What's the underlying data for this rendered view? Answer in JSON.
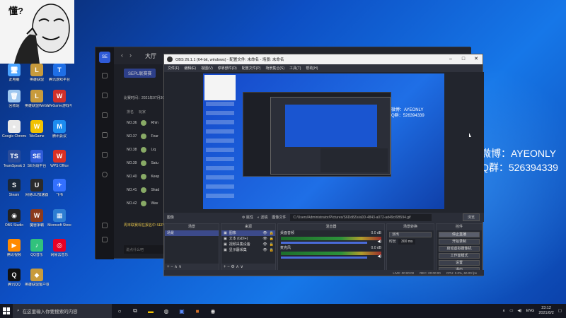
{
  "meme": {
    "caption": "懂?"
  },
  "desktop_icons": [
    {
      "label": "此电脑",
      "icon": "computer-icon",
      "color": "#4aa3ff",
      "glyph": "🖥"
    },
    {
      "label": "英雄联盟",
      "icon": "lol-icon",
      "color": "#c89b3c",
      "glyph": "L"
    },
    {
      "label": "腾讯游戏平台",
      "icon": "tencent-games-icon",
      "color": "#1f6fe6",
      "glyph": "T"
    },
    {
      "label": "回收站",
      "icon": "recycle-bin-icon",
      "color": "#9ec7ef",
      "glyph": "🗑"
    },
    {
      "label": "英雄联盟WeGame版",
      "icon": "lol-wegame-icon",
      "color": "#c89b3c",
      "glyph": "L"
    },
    {
      "label": "WeGame游戏平台",
      "icon": "wegame-icon",
      "color": "#d0302a",
      "glyph": "W"
    },
    {
      "label": "Google Chrome",
      "icon": "chrome-icon",
      "color": "#e8e8e8",
      "glyph": "●"
    },
    {
      "label": "WeGame",
      "icon": "wegame-yellow-icon",
      "color": "#f2c200",
      "glyph": "W"
    },
    {
      "label": "腾讯会议",
      "icon": "tencent-meeting-icon",
      "color": "#1c8cf0",
      "glyph": "M"
    },
    {
      "label": "TeamSpeak 3",
      "icon": "teamspeak-icon",
      "color": "#2a4c9a",
      "glyph": "TS"
    },
    {
      "label": "SE对战平台",
      "icon": "se-icon",
      "color": "#2f5bd8",
      "glyph": "SE"
    },
    {
      "label": "WPS Office",
      "icon": "wps-icon",
      "color": "#d93025",
      "glyph": "W"
    },
    {
      "label": "Steam",
      "icon": "steam-icon",
      "color": "#1b2838",
      "glyph": "S"
    },
    {
      "label": "网易UU加速器",
      "icon": "uu-icon",
      "color": "#2b2b2b",
      "glyph": "U"
    },
    {
      "label": "飞书",
      "icon": "feishu-icon",
      "color": "#3370ff",
      "glyph": "✈"
    },
    {
      "label": "OBS Studio",
      "icon": "obs-icon",
      "color": "#222",
      "glyph": "◉"
    },
    {
      "label": "魔兽争霸",
      "icon": "warcraft-icon",
      "color": "#8a3a1c",
      "glyph": "W"
    },
    {
      "label": "Microsoft Store",
      "icon": "store-icon",
      "color": "#2d7dd2",
      "glyph": "▦"
    },
    {
      "label": "腾讯视频",
      "icon": "tencent-video-icon",
      "color": "#ff8a00",
      "glyph": "▶"
    },
    {
      "label": "QQ音乐",
      "icon": "qq-music-icon",
      "color": "#31c27c",
      "glyph": "♪"
    },
    {
      "label": "网易云音乐",
      "icon": "netease-music-icon",
      "color": "#e60026",
      "glyph": "◎"
    },
    {
      "label": "腾讯QQ",
      "icon": "qq-icon",
      "color": "#111",
      "glyph": "Q"
    },
    {
      "label": "英雄联盟客户端",
      "icon": "lol-client-icon",
      "color": "#c89b3c",
      "glyph": "◆"
    }
  ],
  "watermark": {
    "weibo": "微博：AYEONLY",
    "qq": "Q群：526394339"
  },
  "back_app": {
    "title": "大厅",
    "logo": "SE",
    "tab": "SEPL联赛赛",
    "time": "比赛时间：2021年07月30",
    "col_rank": "排名",
    "col_player": "玩家",
    "rows": [
      {
        "rank": "NO.36",
        "name": "Rhin"
      },
      {
        "rank": "NO.37",
        "name": "Fear"
      },
      {
        "rank": "NO.38",
        "name": "Liq"
      },
      {
        "rank": "NO.39",
        "name": "Satu"
      },
      {
        "rank": "NO.40",
        "name": "Keep"
      },
      {
        "rank": "NO.41",
        "name": "Shad"
      },
      {
        "rank": "NO.42",
        "name": "Wav"
      }
    ],
    "notice": "周末联赛现在报名中 SEPL",
    "input_placeholder": "说点什么吧"
  },
  "obs": {
    "title": "OBS 26.1.1 (64-bit, windows) - 配置文件: 未命名 - 场景: 未命名",
    "menu": [
      "文件(F)",
      "编辑(E)",
      "视图(V)",
      "停靠部件(D)",
      "配置文件(P)",
      "场景集合(S)",
      "工具(T)",
      "帮助(H)"
    ],
    "source_label": "图像",
    "props_btn": "属性",
    "filters_btn": "滤镜",
    "image_file_label": "图像文件",
    "image_path": "C:/Users/Administrator/Pictures/S6Dd8Ze/a0D-4843-a072-ad49c/6B594.gif",
    "browse_btn": "浏览",
    "scenes_header": "场景",
    "scenes": [
      "场景"
    ],
    "sources_header": "来源",
    "sources": [
      "图像",
      "文本 (GDI+)",
      "视频采集设备",
      "显示器采集"
    ],
    "mixer_header": "混音器",
    "mixer": [
      {
        "name": "桌面音频",
        "level": "0.0 dB"
      },
      {
        "name": "麦克风",
        "level": "0.0 dB"
      }
    ],
    "transitions_header": "场景转换",
    "transition": "淡出",
    "duration_label": "时长",
    "duration": "300 ms",
    "controls_header": "控件",
    "controls": [
      "停止直播",
      "开始录制",
      "启动虚拟摄像机",
      "工作室模式",
      "设置",
      "退出"
    ],
    "status": [
      "LIVE: 00:00:00",
      "REC: 00:00:00",
      "CPU: 0.0%, 60.00 fps"
    ]
  },
  "taskbar": {
    "search_placeholder": "在这里输入你要搜索的内容",
    "lang": "ENG",
    "time": "23:12",
    "date": "2021/8/2"
  }
}
